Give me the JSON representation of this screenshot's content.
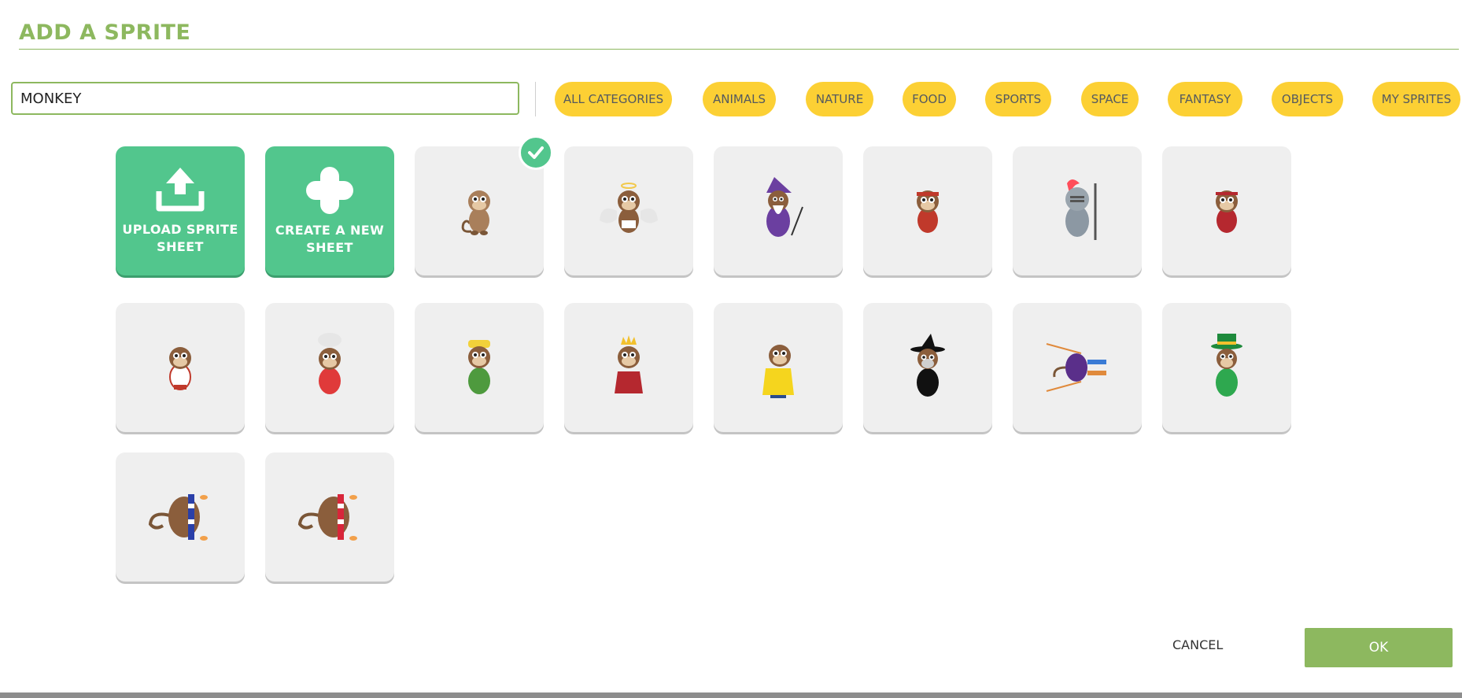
{
  "dialog": {
    "title": "ADD A SPRITE"
  },
  "search": {
    "value": "MONKEY"
  },
  "categories": [
    "ALL CATEGORIES",
    "ANIMALS",
    "NATURE",
    "FOOD",
    "SPORTS",
    "SPACE",
    "FANTASY",
    "OBJECTS",
    "MY SPRITES"
  ],
  "actions": {
    "upload_label": "UPLOAD SPRITE SHEET",
    "create_label": "CREATE A NEW SHEET"
  },
  "sprites": [
    {
      "name": "monkey",
      "selected": true
    },
    {
      "name": "monkey-angel"
    },
    {
      "name": "monkey-wizard"
    },
    {
      "name": "monkey-red-headband"
    },
    {
      "name": "monkey-knight"
    },
    {
      "name": "monkey-jersey-14"
    },
    {
      "name": "monkey-white-jersey-14"
    },
    {
      "name": "monkey-chef"
    },
    {
      "name": "monkey-yellow-hat"
    },
    {
      "name": "monkey-king"
    },
    {
      "name": "monkey-raincoat"
    },
    {
      "name": "monkey-witch"
    },
    {
      "name": "monkey-ski"
    },
    {
      "name": "monkey-leprechaun"
    },
    {
      "name": "monkey-blue-scarf"
    },
    {
      "name": "monkey-red-scarf"
    }
  ],
  "footer": {
    "cancel_label": "CANCEL",
    "ok_label": "OK"
  },
  "colors": {
    "accent": "#8db85f",
    "chip": "#fcd034",
    "action_tile": "#52c68d",
    "tile": "#efefef"
  }
}
